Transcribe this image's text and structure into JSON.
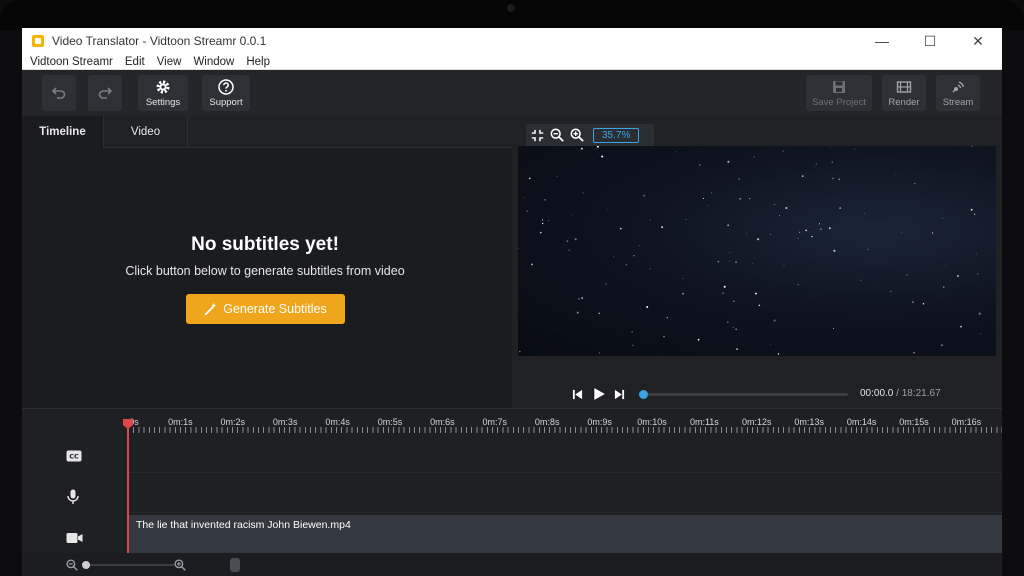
{
  "window": {
    "title": "Video Translator - Vidtoon Streamr 0.0.1",
    "minimize": "—",
    "maximize": "☐",
    "close": "✕"
  },
  "menu": [
    "Vidtoon Streamr",
    "Edit",
    "View",
    "Window",
    "Help"
  ],
  "toolbar": {
    "undo_icon": "undo-icon",
    "redo_icon": "redo-icon",
    "settings_label": "Settings",
    "support_label": "Support",
    "save_label": "Save Project",
    "render_label": "Render",
    "stream_label": "Stream"
  },
  "tabs": [
    "Timeline",
    "Video"
  ],
  "empty_state": {
    "title": "No subtitles yet!",
    "subtitle": "Click button below to generate subtitles from video",
    "button": "Generate Subtitles"
  },
  "preview": {
    "zoom": "35.7%"
  },
  "player": {
    "current": "00:00.0",
    "separator": " / ",
    "total": "18:21.67",
    "progress": 0
  },
  "timeline": {
    "ticks": [
      "0s",
      "0m:1s",
      "0m:2s",
      "0m:3s",
      "0m:4s",
      "0m:5s",
      "0m:6s",
      "0m:7s",
      "0m:8s",
      "0m:9s",
      "0m:10s",
      "0m:11s",
      "0m:12s",
      "0m:13s",
      "0m:14s",
      "0m:15s",
      "0m:16s"
    ],
    "clip_name": "The lie that invented racism John Biewen.mp4",
    "cc_label": "CC"
  },
  "colors": {
    "accent": "#3aa3e3",
    "button": "#f0a61c",
    "playhead": "#e04848"
  }
}
